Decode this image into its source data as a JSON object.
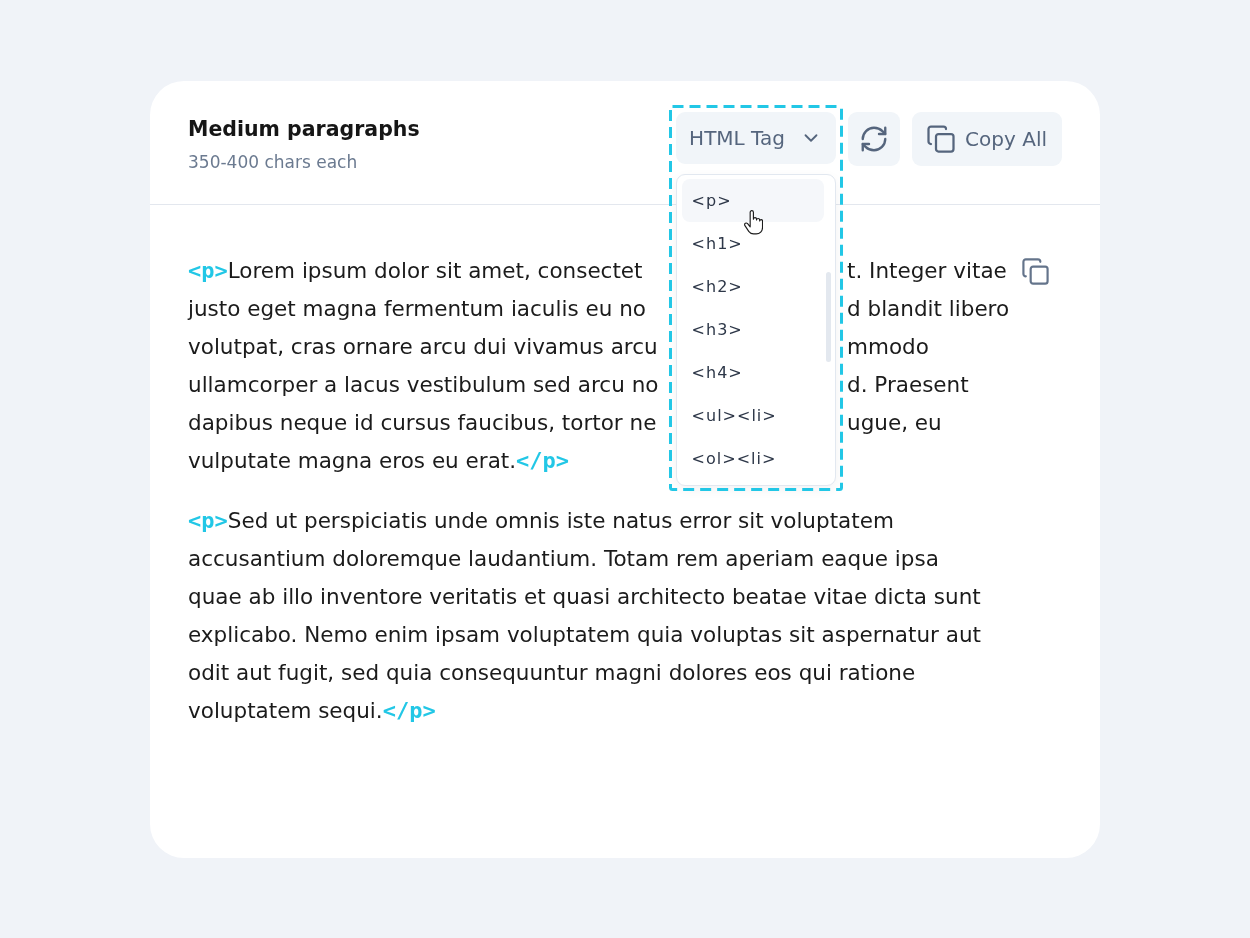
{
  "header": {
    "title": "Medium paragraphs",
    "subtitle": "350-400 chars each"
  },
  "toolbar": {
    "tag_select": {
      "label": "HTML Tag",
      "expanded": true,
      "highlighted": true,
      "options": [
        {
          "label": "<p>",
          "selected": true
        },
        {
          "label": "<h1>",
          "selected": false
        },
        {
          "label": "<h2>",
          "selected": false
        },
        {
          "label": "<h3>",
          "selected": false
        },
        {
          "label": "<h4>",
          "selected": false
        },
        {
          "label": "<ul><li>",
          "selected": false
        },
        {
          "label": "<ol><li>",
          "selected": false
        }
      ]
    },
    "copy_all": {
      "label": "Copy All"
    }
  },
  "paragraphs": [
    {
      "kind": "partly_covered",
      "hovered": true,
      "open_tag": "<p>",
      "close_tag": "</p>",
      "lines": [
        {
          "left": "Lorem ipsum dolor sit amet, consectet",
          "right": "t. Integer vitae"
        },
        {
          "left": "justo eget magna fermentum iaculis eu no",
          "right": "d blandit libero"
        },
        {
          "left": "volutpat, cras ornare arcu dui vivamus arcu",
          "right": "mmodo"
        },
        {
          "left": "ullamcorper a lacus vestibulum sed arcu no",
          "right": "d. Praesent"
        },
        {
          "left": "dapibus neque id cursus faucibus, tortor ne",
          "right": "ugue, eu"
        },
        {
          "left": "vulputate magna eros eu erat."
        }
      ]
    },
    {
      "kind": "full",
      "hovered": false,
      "open_tag": "<p>",
      "close_tag": "</p>",
      "lines": [
        "Sed ut perspiciatis unde omnis iste natus error sit voluptatem",
        "accusantium doloremque laudantium. Totam rem aperiam eaque ipsa",
        "quae ab illo inventore veritatis et quasi architecto beatae vitae dicta sunt",
        "explicabo. Nemo enim ipsam voluptatem quia voluptas sit aspernatur aut",
        "odit aut fugit, sed quia consequuntur magni dolores eos qui ratione",
        "voluptatem sequi."
      ]
    }
  ]
}
